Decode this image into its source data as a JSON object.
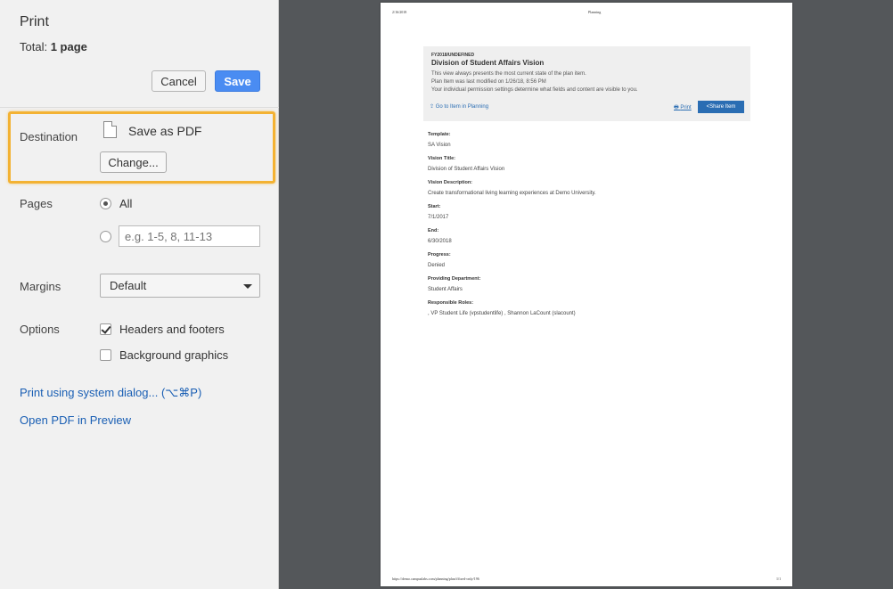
{
  "panel": {
    "title": "Print",
    "total_label": "Total:",
    "total_value": "1 page",
    "cancel_label": "Cancel",
    "save_label": "Save",
    "destination": {
      "label": "Destination",
      "value": "Save as PDF",
      "change_label": "Change..."
    },
    "pages": {
      "label": "Pages",
      "all_label": "All",
      "custom_placeholder": "e.g. 1-5, 8, 11-13"
    },
    "margins": {
      "label": "Margins",
      "selected": "Default"
    },
    "options": {
      "label": "Options",
      "headers_footers": "Headers and footers",
      "background_graphics": "Background graphics"
    },
    "system_dialog_link": "Print using system dialog... (⌥⌘P)",
    "open_pdf_link": "Open PDF in Preview"
  },
  "preview": {
    "header_date": "2/16/2018",
    "header_title": "Planning",
    "footer_url": "https://demo.campuslabs.com/planning/plan/i/fixed-only/196",
    "footer_page": "1/1",
    "info": {
      "fy": "FY2018/UNDEFINED",
      "title": "Division of Student Affairs Vision",
      "line1": "This view always presents the most current state of the plan item.",
      "line2": "Plan Item was last modified on 1/26/18, 8:56 PM",
      "line3": "Your individual permission settings determine what fields and content are visible to you.",
      "goto": "Go to Item in Planning",
      "print": "Print",
      "share": "Share Item"
    },
    "fields": [
      {
        "label": "Template:",
        "value": "SA Vision"
      },
      {
        "label": "Vision Title:",
        "value": "Division of Student Affairs Vision"
      },
      {
        "label": "Vision Description:",
        "value": "Create transformational living learning experiences at Demo University."
      },
      {
        "label": "Start:",
        "value": "7/1/2017"
      },
      {
        "label": "End:",
        "value": "6/30/2018"
      },
      {
        "label": "Progress:",
        "value": "Denied"
      },
      {
        "label": "Providing Department:",
        "value": "Student Affairs"
      },
      {
        "label": "Responsible Roles:",
        "value": ", VP Student Life (vpstudentlife) , Shannon LaCount (slacount)"
      }
    ]
  },
  "colors": {
    "accent": "#4a8cf2",
    "highlight": "#f3b233",
    "link": "#1a5fb4"
  }
}
